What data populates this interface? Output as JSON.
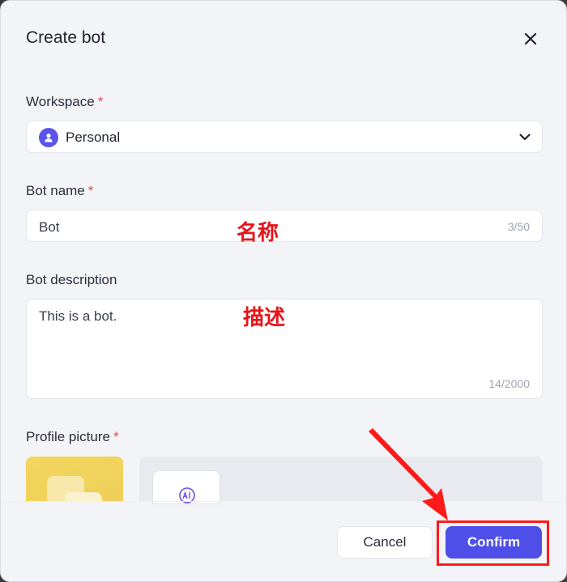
{
  "dialog": {
    "title": "Create bot",
    "close_icon": "close-icon"
  },
  "workspace": {
    "label": "Workspace",
    "required_mark": "*",
    "value": "Personal",
    "icon": "user-icon"
  },
  "bot_name": {
    "label": "Bot name",
    "required_mark": "*",
    "value": "Bot",
    "counter": "3/50",
    "annotation": "名称"
  },
  "bot_description": {
    "label": "Bot description",
    "value": "This is a bot.",
    "counter": "14/2000",
    "annotation": "描述"
  },
  "profile_picture": {
    "label": "Profile picture",
    "required_mark": "*",
    "ai_icon": "ai-generate-icon"
  },
  "footer": {
    "cancel_label": "Cancel",
    "confirm_label": "Confirm"
  },
  "colors": {
    "accent": "#4e4ee8",
    "annotation_red": "#ff1a1a",
    "required": "#e5484d"
  }
}
